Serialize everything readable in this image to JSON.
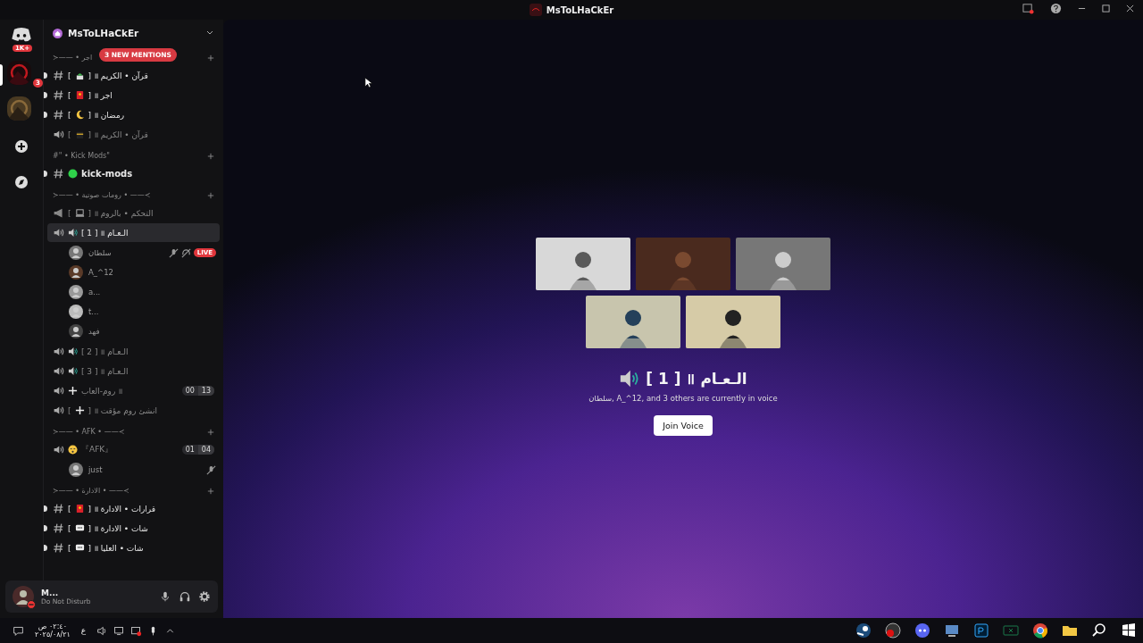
{
  "title_bar": {
    "title": "MsToLHaCkEr"
  },
  "servers": [
    {
      "kind": "home",
      "badge": "1K+"
    },
    {
      "kind": "server",
      "badge": "3",
      "selected": true
    },
    {
      "kind": "server",
      "selected": false
    },
    {
      "kind": "add"
    },
    {
      "kind": "explore"
    }
  ],
  "server_header": {
    "name": "MsToLHaCkEr"
  },
  "mentions_pill": "3 NEW MENTIONS",
  "categories": [
    {
      "title": "≻—— • اجر",
      "channels": [
        {
          "kind": "text",
          "unread": true,
          "selected": false,
          "lead": "[",
          "icon": {
            "kind": "mosque"
          },
          "name": "] ॥ قرآن • الكريم"
        },
        {
          "kind": "text",
          "unread": true,
          "selected": false,
          "lead": "[",
          "icon": {
            "kind": "red"
          },
          "name": "] ॥ اجر"
        },
        {
          "kind": "text",
          "unread": true,
          "selected": false,
          "lead": "[",
          "icon": {
            "kind": "moon"
          },
          "name": "] ॥ رمضان"
        },
        {
          "kind": "voice",
          "unread": false,
          "selected": false,
          "lead": "[",
          "icon": {
            "kind": "kaaba"
          },
          "name": "] ॥ قرآن • الكريم"
        }
      ]
    },
    {
      "title": "#\" • Kick Mods\"",
      "channels": [
        {
          "kind": "text",
          "unread": true,
          "selected": false,
          "icon": {
            "kind": "green"
          },
          "name": "kick-mods"
        }
      ]
    },
    {
      "title": "≻—— • رومات صوتية • ——≺",
      "channels": [
        {
          "kind": "stage",
          "unread": false,
          "selected": false,
          "lead": "[",
          "icon": {
            "kind": "laptop"
          },
          "name": "] ॥ التحكم • بالروم"
        },
        {
          "kind": "voice",
          "unread": false,
          "selected": true,
          "icon": {
            "kind": "speaker"
          },
          "name": "[ 1 ] ॥ الـعـام",
          "users": [
            {
              "name": "سلطان",
              "live": "LIVE",
              "muted": true
            },
            {
              "name": "A_^12",
              "muted": false
            },
            {
              "name": "a...",
              "muted": false
            },
            {
              "name": "t...",
              "muted": false
            },
            {
              "name": "فهد",
              "muted": false
            }
          ]
        },
        {
          "kind": "voice",
          "unread": false,
          "selected": false,
          "icon": {
            "kind": "speaker"
          },
          "name": "[ 2 ] ॥ الـعـام"
        },
        {
          "kind": "voice",
          "unread": false,
          "selected": false,
          "icon": {
            "kind": "speaker"
          },
          "name": "[ 3 ] ॥ الـعـام"
        },
        {
          "kind": "voice",
          "unread": false,
          "selected": false,
          "icon": {
            "kind": "plus"
          },
          "name": "روم-العاب ॥",
          "count": "00",
          "limit": "13"
        },
        {
          "kind": "voice-add",
          "unread": false,
          "selected": false,
          "lead": "[",
          "icon": {
            "kind": "plus"
          },
          "name": "] ॥ انشئ روم مؤقت"
        }
      ]
    },
    {
      "title": "≻—— • AFK • ——≺",
      "channels": [
        {
          "kind": "voice",
          "unread": false,
          "selected": false,
          "icon": {
            "kind": "sleepy"
          },
          "name": "『AFK』",
          "count": "01",
          "limit": "04",
          "users": [
            {
              "name": "just",
              "muted": true
            }
          ]
        }
      ]
    },
    {
      "title": "≻—— • الادارة • ——≺",
      "channels": [
        {
          "kind": "text",
          "unread": true,
          "selected": false,
          "lead": "[",
          "icon": {
            "kind": "red"
          },
          "name": "] ॥ قرارات • الادارة"
        },
        {
          "kind": "text",
          "unread": true,
          "selected": false,
          "lead": "[",
          "icon": {
            "kind": "chat"
          },
          "name": "] ॥ شات • الادارة"
        },
        {
          "kind": "text",
          "unread": true,
          "selected": false,
          "lead": "[",
          "icon": {
            "kind": "chat"
          },
          "name": "] ॥ شات • العليا"
        }
      ]
    }
  ],
  "user_panel": {
    "name": "M...",
    "status": "Do Not Disturb"
  },
  "voice_preview": {
    "icon": {
      "kind": "speaker"
    },
    "title": "[ 1 ] ॥ الـعـام",
    "subtitle": "سلطان, A_^12, and 3 others are currently in voice",
    "button": "Join Voice"
  },
  "taskbar": {
    "time": "٠٢:٤٠ ص",
    "date": "٢٠٢٥/٠٨/٢١",
    "language": "ع"
  }
}
